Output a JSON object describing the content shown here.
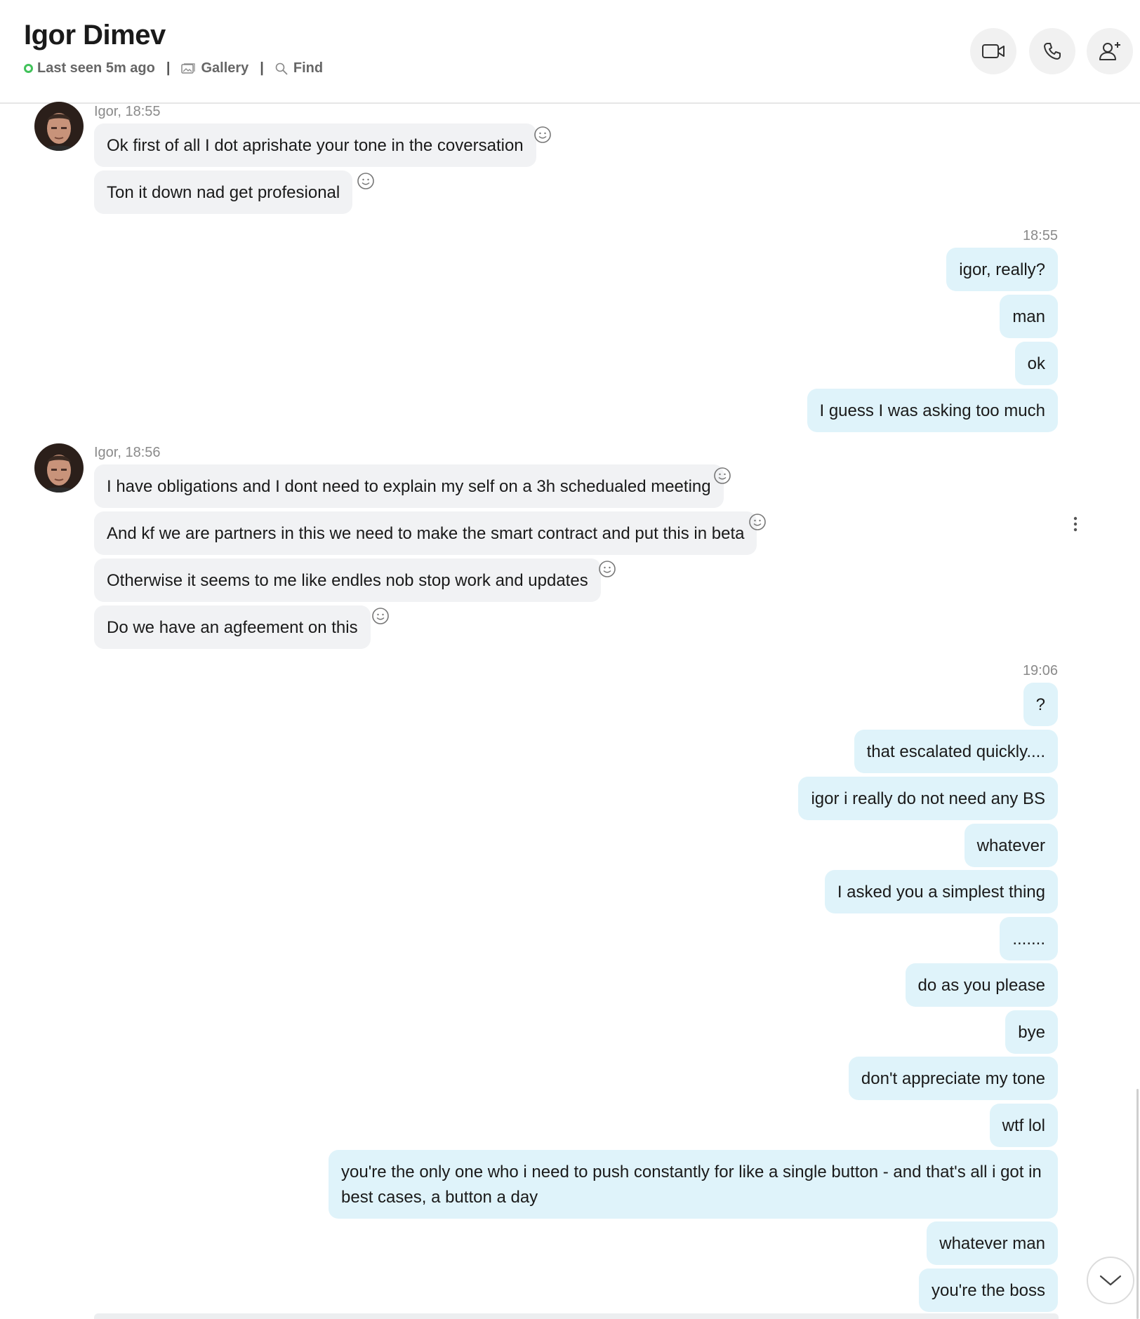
{
  "header": {
    "contact_name": "Igor Dimev",
    "status": "Last seen 5m ago",
    "separator": "|",
    "gallery_label": "Gallery",
    "find_label": "Find",
    "status_color": "#41c25a"
  },
  "icons": {
    "video": "video-camera-icon",
    "call": "phone-icon",
    "add_person": "add-person-icon",
    "reaction": "smiley-icon",
    "more": "more-vertical-icon",
    "scroll_down": "chevron-down-icon"
  },
  "colors": {
    "incoming_bubble": "#f1f2f4",
    "outgoing_bubble": "#dff3fa",
    "meta_text": "#8a8a8a"
  },
  "groups": [
    {
      "meta": "Igor, 18:55",
      "messages": [
        "Ok first of all I dot aprishate your tone in the coversation",
        "Ton it down nad get profesional"
      ]
    },
    {
      "meta": "18:55",
      "messages": [
        "igor, really?",
        "man",
        "ok",
        "I guess I was asking too much"
      ]
    },
    {
      "meta": "Igor, 18:56",
      "messages": [
        "I have obligations and I dont need to explain my self on a 3h schedualed meeting",
        "And kf we are partners in this we need to make the smart contract and put this in beta",
        "Otherwise it seems to me like endles nob stop work and updates",
        "Do we have an agfeement on this"
      ]
    },
    {
      "meta": "19:06",
      "messages": [
        "?",
        "that escalated quickly....",
        "igor i really do not need any BS",
        "whatever",
        "I asked you a simplest thing",
        ".......",
        "do as you please",
        "bye",
        "don't appreciate my tone",
        "wtf lol",
        "you're the only one who i need to push constantly for like a single button - and that's all i got in best cases, a button a day",
        "whatever man",
        "you're the boss"
      ]
    }
  ]
}
